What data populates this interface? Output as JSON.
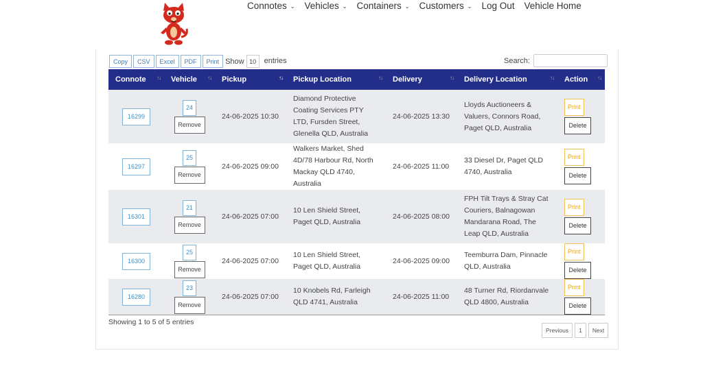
{
  "nav": [
    {
      "label": "Connotes",
      "caret": "⌄"
    },
    {
      "label": "Vehicles",
      "caret": "⌄"
    },
    {
      "label": "Containers",
      "caret": "⌄"
    },
    {
      "label": "Customers",
      "caret": "⌄"
    },
    {
      "label": "Log Out",
      "caret": ""
    },
    {
      "label": "Vehicle Home",
      "caret": ""
    }
  ],
  "toolbar": {
    "copy": "Copy",
    "csv": "CSV",
    "excel": "Excel",
    "pdf": "PDF",
    "print": "Print"
  },
  "length": {
    "show": "Show",
    "value": "10",
    "entries": "entries"
  },
  "search": {
    "label": "Search:",
    "value": ""
  },
  "table": {
    "headers": [
      "Connote",
      "Vehicle",
      "Pickup",
      "Pickup Location",
      "Delivery",
      "Delivery Location",
      "Action"
    ],
    "remove_label": "Remove",
    "print_label": "Print",
    "delete_label": "Delete",
    "rows": [
      {
        "connote": "16299",
        "vehicle": "24",
        "pickup": "24-06-2025 10:30",
        "pickup_location": "Diamond Protective Coating Services PTY LTD, Fursden Street, Glenella QLD, Australia",
        "delivery": "24-06-2025 13:30",
        "delivery_location": "Lloyds Auctioneers & Valuers, Connors Road, Paget QLD, Australia"
      },
      {
        "connote": "16297",
        "vehicle": "25",
        "pickup": "24-06-2025 09:00",
        "pickup_location": "Walkers Market, Shed 4D/78 Harbour Rd, North Mackay QLD 4740, Australia",
        "delivery": "24-06-2025 11:00",
        "delivery_location": "33 Diesel Dr, Paget QLD 4740, Australia"
      },
      {
        "connote": "16301",
        "vehicle": "21",
        "pickup": "24-06-2025 07:00",
        "pickup_location": "10 Len Shield Street, Paget QLD, Australia",
        "delivery": "24-06-2025 08:00",
        "delivery_location": "FPH Tilt Trays & Stray Cat Couriers, Balnagowan Mandarana Road, The Leap QLD, Australia"
      },
      {
        "connote": "16300",
        "vehicle": "25",
        "pickup": "24-06-2025 07:00",
        "pickup_location": "10 Len Shield Street, Paget QLD, Australia",
        "delivery": "24-06-2025 09:00",
        "delivery_location": "Teemburra Dam, Pinnacle QLD, Australia"
      },
      {
        "connote": "16280",
        "vehicle": "23",
        "pickup": "24-06-2025 07:00",
        "pickup_location": "10 Knobels Rd, Farleigh QLD 4741, Australia",
        "delivery": "24-06-2025 11:00",
        "delivery_location": "48 Turner Rd, Riordanvale QLD 4800, Australia"
      }
    ]
  },
  "info": "Showing 1 to 5 of 5 entries",
  "pager": {
    "previous": "Previous",
    "page": "1",
    "next": "Next"
  },
  "colors": {
    "header_bg": "#232e8a",
    "odd_row": "#e9ebee",
    "link_blue": "#3d8fc4",
    "print_orange": "#f0a500",
    "logo_red": "#d42a1e"
  },
  "icons": {
    "logo": "red-cartoon-cat-logo",
    "sort": "sort-arrows-icon"
  }
}
